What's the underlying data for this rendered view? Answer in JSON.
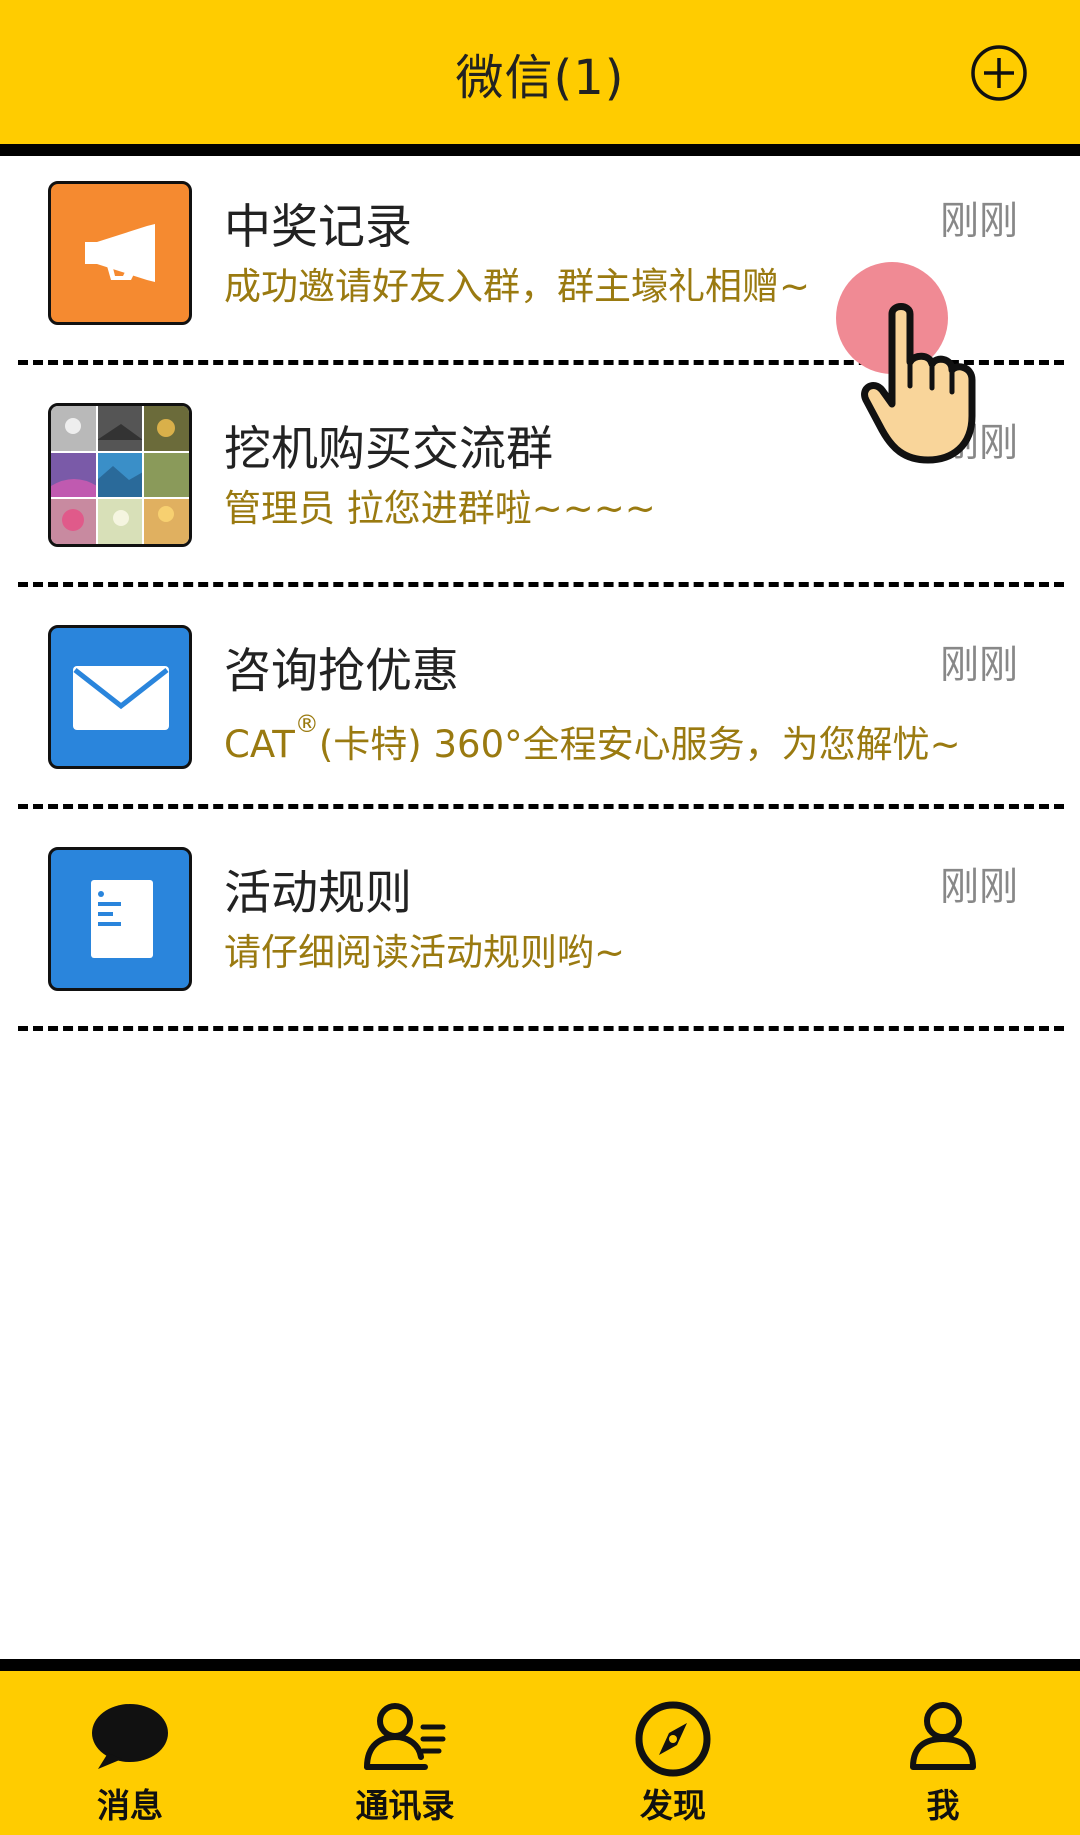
{
  "header": {
    "title": "微信(1)",
    "add_icon": "plus-circle-icon"
  },
  "chats": [
    {
      "title": "中奖记录",
      "message": "成功邀请好友入群，群主壕礼相赠~",
      "time": "刚刚",
      "avatar_icon": "megaphone-icon",
      "avatar_color": "#f58a30"
    },
    {
      "title": "挖机购买交流群",
      "message": "管理员 拉您进群啦~~~~",
      "time": "刚刚",
      "avatar_icon": "photo-grid-icon",
      "avatar_color": "#888888"
    },
    {
      "title": "咨询抢优惠",
      "message_prefix": "CAT",
      "message_reg": "®",
      "message_suffix": "(卡特) 360°全程安心服务，为您解忧~",
      "time": "刚刚",
      "avatar_icon": "envelope-icon",
      "avatar_color": "#2a85dc"
    },
    {
      "title": "活动规则",
      "message": "请仔细阅读活动规则哟~",
      "time": "刚刚",
      "avatar_icon": "document-icon",
      "avatar_color": "#2a85dc"
    }
  ],
  "bottom_nav": [
    {
      "label": "消息",
      "icon": "chat-bubble-icon"
    },
    {
      "label": "通讯录",
      "icon": "contacts-icon"
    },
    {
      "label": "发现",
      "icon": "compass-icon"
    },
    {
      "label": "我",
      "icon": "person-icon"
    }
  ],
  "colors": {
    "accent": "#ffcc00",
    "message_text": "#9a7a10",
    "time_text": "#888888"
  }
}
